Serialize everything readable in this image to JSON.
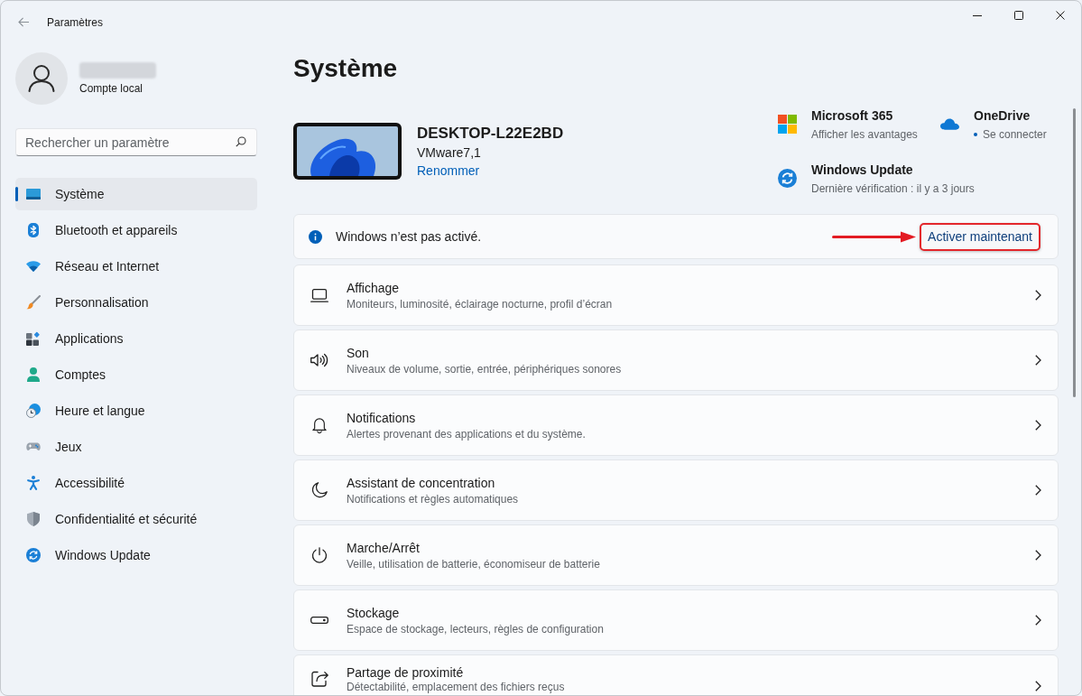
{
  "window": {
    "title": "Paramètres"
  },
  "account": {
    "type": "Compte local"
  },
  "search": {
    "placeholder": "Rechercher un paramètre"
  },
  "sidebar": {
    "items": [
      {
        "label": "Système",
        "selected": true
      },
      {
        "label": "Bluetooth et appareils",
        "selected": false
      },
      {
        "label": "Réseau et Internet",
        "selected": false
      },
      {
        "label": "Personnalisation",
        "selected": false
      },
      {
        "label": "Applications",
        "selected": false
      },
      {
        "label": "Comptes",
        "selected": false
      },
      {
        "label": "Heure et langue",
        "selected": false
      },
      {
        "label": "Jeux",
        "selected": false
      },
      {
        "label": "Accessibilité",
        "selected": false
      },
      {
        "label": "Confidentialité et sécurité",
        "selected": false
      },
      {
        "label": "Windows Update",
        "selected": false
      }
    ]
  },
  "page": {
    "title": "Système"
  },
  "device": {
    "name": "DESKTOP-L22E2BD",
    "model": "VMware7,1",
    "rename_link": "Renommer"
  },
  "services": [
    {
      "title": "Microsoft 365",
      "subtitle": "Afficher les avantages",
      "alert": false
    },
    {
      "title": "OneDrive",
      "subtitle": "Se connecter",
      "alert": true
    },
    {
      "title": "Windows Update",
      "subtitle": "Dernière vérification : il y a 3 jours",
      "alert": false
    }
  ],
  "activation": {
    "message": "Windows n’est pas activé.",
    "button": "Activer maintenant",
    "highlighted": true
  },
  "settings": [
    {
      "title": "Affichage",
      "subtitle": "Moniteurs, luminosité, éclairage nocturne, profil d’écran"
    },
    {
      "title": "Son",
      "subtitle": "Niveaux de volume, sortie, entrée, périphériques sonores"
    },
    {
      "title": "Notifications",
      "subtitle": "Alertes provenant des applications et du système."
    },
    {
      "title": "Assistant de concentration",
      "subtitle": "Notifications et règles automatiques"
    },
    {
      "title": "Marche/Arrêt",
      "subtitle": "Veille, utilisation de batterie, économiseur de batterie"
    },
    {
      "title": "Stockage",
      "subtitle": "Espace de stockage, lecteurs, règles de configuration"
    },
    {
      "title": "Partage de proximité",
      "subtitle": "Détectabilité, emplacement des fichiers reçus"
    }
  ]
}
